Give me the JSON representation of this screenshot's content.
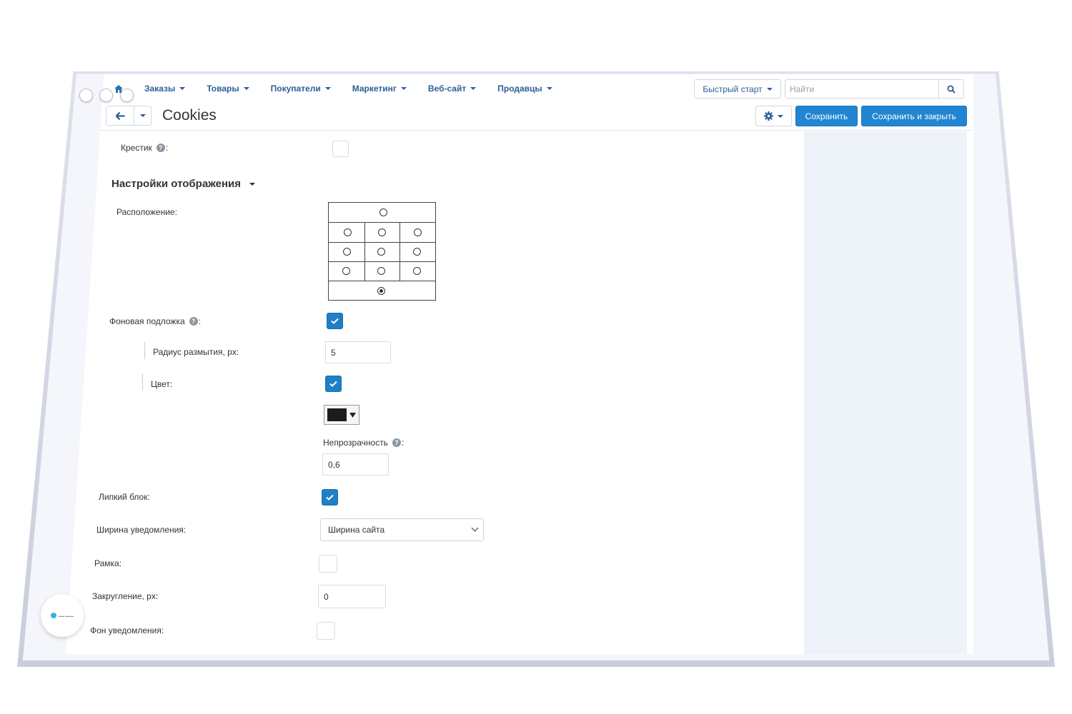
{
  "nav": {
    "items": [
      "Заказы",
      "Товары",
      "Покупатели",
      "Маркетинг",
      "Веб-сайт",
      "Продавцы"
    ],
    "quick_start": "Быстрый старт",
    "search_placeholder": "Найти"
  },
  "toolbar": {
    "title": "Cookies",
    "save_label": "Сохранить",
    "save_close_label": "Сохранить и закрыть"
  },
  "form": {
    "close_cross_label": "Крестик",
    "close_cross_checked": false,
    "display_section_title": "Настройки отображения",
    "position_label": "Расположение:",
    "position_selected": "bottom-center",
    "backdrop_label": "Фоновая подложка",
    "backdrop_checked": true,
    "blur_label": "Радиус размытия, px:",
    "blur_value": "5",
    "color_label": "Цвет:",
    "color_checked": true,
    "color_value": "#1c1c1c",
    "opacity_label": "Непрозрачность",
    "opacity_value": "0,6",
    "sticky_label": "Липкий блок:",
    "sticky_checked": true,
    "width_label": "Ширина уведомления:",
    "width_value": "Ширина сайта",
    "border_label": "Рамка:",
    "border_checked": false,
    "radius_label": "Закругление, px:",
    "radius_value": "0",
    "bg_label": "Фон уведомления:",
    "bg_checked": false
  },
  "colors": {
    "accent": "#2186d1",
    "link": "#2b5f96"
  }
}
